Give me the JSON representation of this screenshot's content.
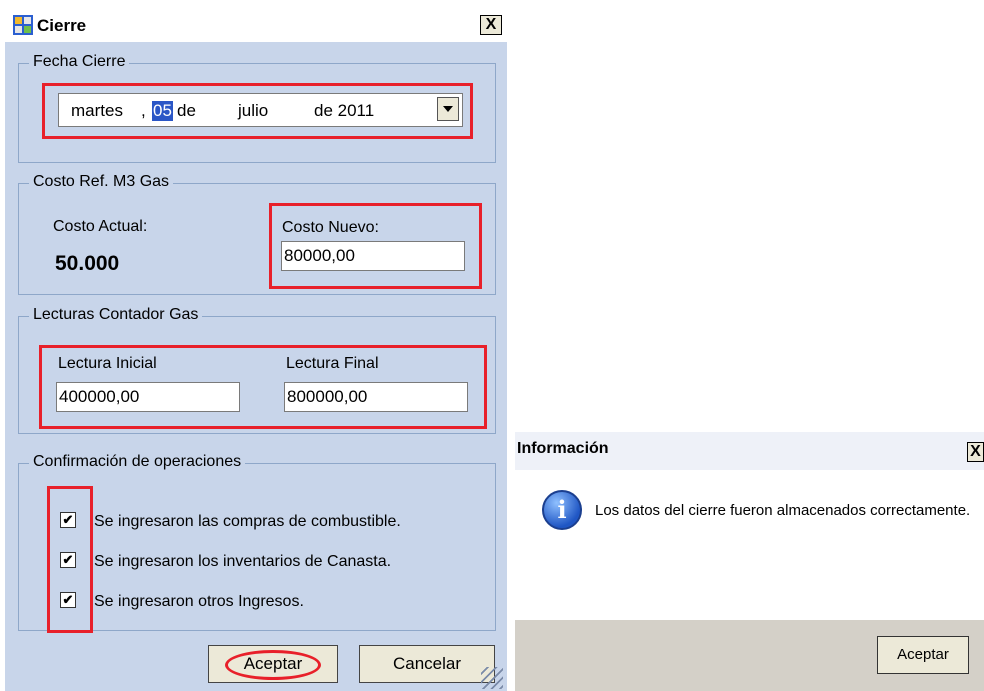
{
  "cierre": {
    "title": "Cierre",
    "close": "X",
    "fecha": {
      "group_title": "Fecha Cierre",
      "weekday": "martes",
      "comma": ",",
      "day": "05",
      "de1": "de",
      "month": "julio",
      "year_text": "de 2011"
    },
    "costo": {
      "group_title": "Costo Ref. M3 Gas",
      "actual_label": "Costo Actual:",
      "actual_value": "50.000",
      "nuevo_label": "Costo Nuevo:",
      "nuevo_value": "80000,00"
    },
    "lecturas": {
      "group_title": "Lecturas Contador Gas",
      "inicial_label": "Lectura Inicial",
      "inicial_value": "400000,00",
      "final_label": "Lectura Final",
      "final_value": "800000,00"
    },
    "confirmacion": {
      "group_title": "Confirmación de operaciones",
      "items": [
        {
          "label": "Se ingresaron las compras de combustible.",
          "checked": true
        },
        {
          "label": "Se ingresaron los inventarios de Canasta.",
          "checked": true
        },
        {
          "label": "Se ingresaron otros Ingresos.",
          "checked": true
        }
      ],
      "check_mark": "✔"
    },
    "buttons": {
      "aceptar": "Aceptar",
      "cancelar": "Cancelar"
    },
    "highlight_color": "#e8202a"
  },
  "info": {
    "title": "Información",
    "close": "X",
    "icon": "information-icon",
    "icon_glyph": "i",
    "message": "Los datos del cierre fueron almacenados correctamente.",
    "button": "Aceptar"
  }
}
